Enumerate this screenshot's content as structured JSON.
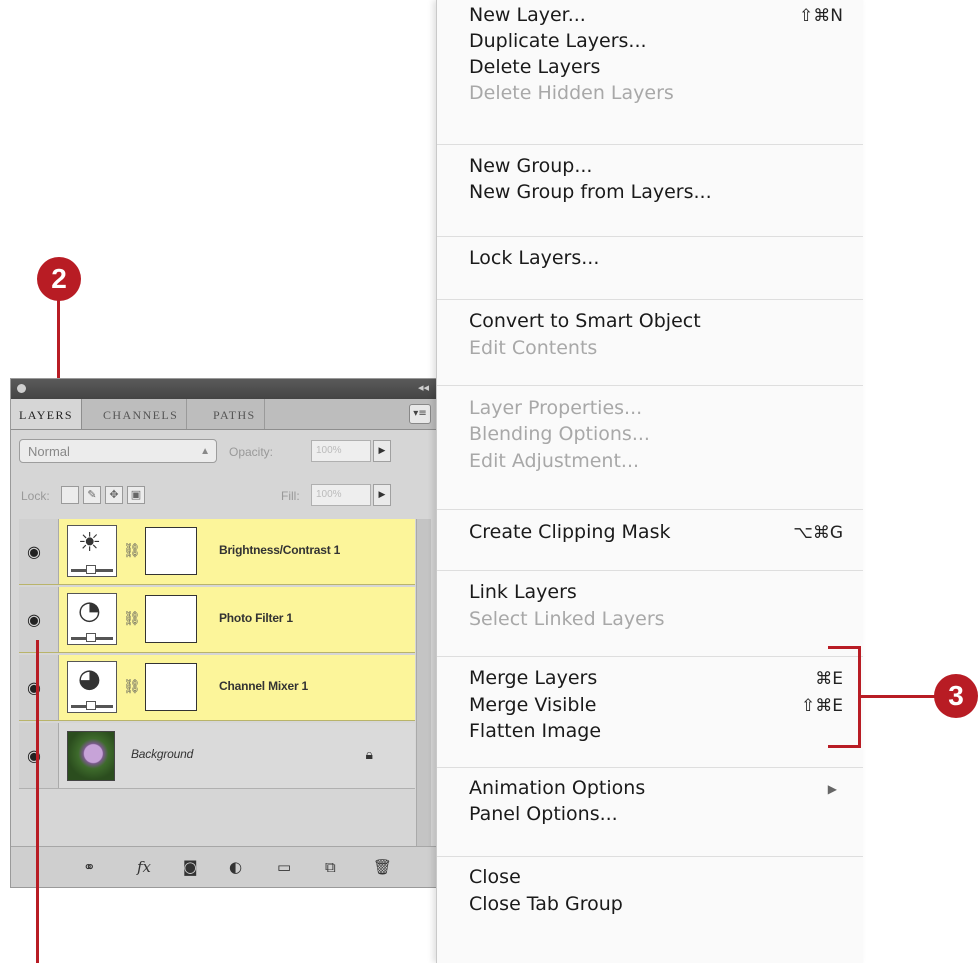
{
  "callouts": {
    "panel_tab": "2",
    "merge_commands": "3"
  },
  "panel": {
    "tabs": [
      "LAYERS",
      "CHANNELS",
      "PATHS"
    ],
    "blend_mode": "Normal",
    "opacity_label": "Opacity:",
    "opacity_value": "100%",
    "lock_label": "Lock:",
    "fill_label": "Fill:",
    "fill_value": "100%",
    "layers": [
      {
        "name": "Brightness/Contrast 1",
        "type": "adjustment",
        "icon": "sun-icon"
      },
      {
        "name": "Photo Filter 1",
        "type": "adjustment",
        "icon": "photo-filter-icon"
      },
      {
        "name": "Channel Mixer 1",
        "type": "adjustment",
        "icon": "channel-mixer-icon"
      },
      {
        "name": "Background",
        "type": "image",
        "locked": true
      }
    ],
    "bottom_icons": [
      "link-icon",
      "fx-icon",
      "mask-icon",
      "adjustment-icon",
      "folder-icon",
      "new-layer-icon",
      "trash-icon"
    ]
  },
  "menu": {
    "groups": [
      [
        {
          "label": "New Layer...",
          "shortcut": "⇧⌘N",
          "enabled": true
        },
        {
          "label": "Duplicate Layers...",
          "enabled": true
        },
        {
          "label": "Delete Layers",
          "enabled": true
        },
        {
          "label": "Delete Hidden Layers",
          "enabled": false
        }
      ],
      [
        {
          "label": "New Group...",
          "enabled": true
        },
        {
          "label": "New Group from Layers...",
          "enabled": true
        }
      ],
      [
        {
          "label": "Lock Layers...",
          "enabled": true
        }
      ],
      [
        {
          "label": "Convert to Smart Object",
          "enabled": true
        },
        {
          "label": "Edit Contents",
          "enabled": false
        }
      ],
      [
        {
          "label": "Layer Properties...",
          "enabled": false
        },
        {
          "label": "Blending Options...",
          "enabled": false
        },
        {
          "label": "Edit Adjustment...",
          "enabled": false
        }
      ],
      [
        {
          "label": "Create Clipping Mask",
          "shortcut": "⌥⌘G",
          "enabled": true
        }
      ],
      [
        {
          "label": "Link Layers",
          "enabled": true
        },
        {
          "label": "Select Linked Layers",
          "enabled": false
        }
      ],
      [
        {
          "label": "Merge Layers",
          "shortcut": "⌘E",
          "enabled": true
        },
        {
          "label": "Merge Visible",
          "shortcut": "⇧⌘E",
          "enabled": true
        },
        {
          "label": "Flatten Image",
          "enabled": true
        }
      ],
      [
        {
          "label": "Animation Options",
          "submenu": true,
          "enabled": true
        },
        {
          "label": "Panel Options...",
          "enabled": true
        }
      ],
      [
        {
          "label": "Close",
          "enabled": true
        },
        {
          "label": "Close Tab Group",
          "enabled": true
        }
      ]
    ]
  },
  "colors": {
    "callout": "#b81c24",
    "adjustment_row": "#fcf59a",
    "disabled_text": "#a8a8a8"
  }
}
